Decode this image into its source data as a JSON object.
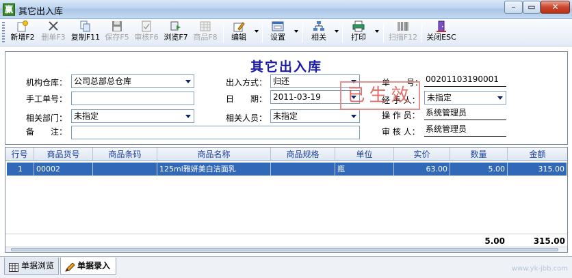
{
  "window": {
    "title": "其它出入库",
    "icon_text": "赢"
  },
  "toolbar": {
    "buttons": [
      {
        "label": "新增F2",
        "icon": "new-doc-icon",
        "enabled": true
      },
      {
        "label": "删单F3",
        "icon": "delete-x-icon",
        "enabled": false
      },
      {
        "label": "复制F11",
        "icon": "copy-icon",
        "enabled": true
      },
      {
        "label": "保存F5",
        "icon": "save-disk-icon",
        "enabled": false
      },
      {
        "label": "审核F6",
        "icon": "audit-check-icon",
        "enabled": false
      },
      {
        "label": "浏览F7",
        "icon": "browse-icon",
        "enabled": true
      },
      {
        "label": "商品F8",
        "icon": "goods-grid-icon",
        "enabled": false
      },
      {
        "label": "编辑",
        "icon": "edit-pencil-icon",
        "enabled": true
      },
      {
        "label": "设置",
        "icon": "settings-window-icon",
        "enabled": true
      },
      {
        "label": "相关",
        "icon": "related-tree-icon",
        "enabled": true
      },
      {
        "label": "打印",
        "icon": "printer-icon",
        "enabled": true
      },
      {
        "label": "扫描F12",
        "icon": "barcode-icon",
        "enabled": false
      },
      {
        "label": "关闭ESC",
        "icon": "close-door-icon",
        "enabled": true
      }
    ]
  },
  "form": {
    "title": "其它出入库",
    "stamp": "已生效",
    "labels": {
      "warehouse": "机构仓库：",
      "manual_no": "手工单号：",
      "department": "相关部门：",
      "remark": "备　　注：",
      "io_type": "出入方式：",
      "date": "日　　期：",
      "related_person": "相关人员：",
      "doc_no": "单　　号：",
      "handler": "经 手 人：",
      "operator": "操 作 员：",
      "auditor": "审 核 人："
    },
    "values": {
      "warehouse": "公司总部总仓库",
      "manual_no": "",
      "department": "未指定",
      "remark": "",
      "io_type": "归还",
      "date": "2011-03-19",
      "related_person": "未指定",
      "doc_no": "00201103190001",
      "handler": "未指定",
      "operator": "系统管理员",
      "auditor": "系统管理员"
    }
  },
  "grid": {
    "columns": [
      "行号",
      "商品货号",
      "商品条码",
      "商品名称",
      "商品规格",
      "单位",
      "实价",
      "数量",
      "金额"
    ],
    "rows": [
      {
        "line": "1",
        "code": "00002",
        "barcode": "",
        "name": "125ml雅妍美白洁面乳",
        "spec": "",
        "unit": "瓶",
        "price": "63.00",
        "qty": "5.00",
        "amount": "315.00"
      }
    ],
    "totals": {
      "qty": "5.00",
      "amount": "315.00"
    }
  },
  "tabs": [
    {
      "label": "单据浏览",
      "icon": "table-grid-icon",
      "active": false
    },
    {
      "label": "单据录入",
      "icon": "pen-edit-icon",
      "active": true
    }
  ],
  "watermark": "www.yk-jbb.com"
}
